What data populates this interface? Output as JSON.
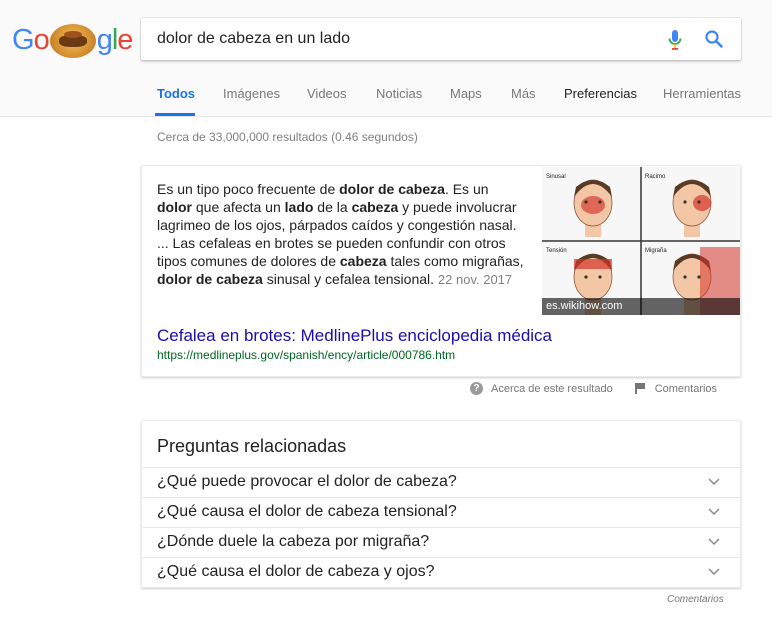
{
  "logo": {
    "letters": [
      "G",
      "o",
      "g",
      "l",
      "e"
    ]
  },
  "search": {
    "query": "dolor de cabeza en un lado"
  },
  "tabs": [
    {
      "label": "Todos"
    },
    {
      "label": "Imágenes"
    },
    {
      "label": "Videos"
    },
    {
      "label": "Noticias"
    },
    {
      "label": "Maps"
    },
    {
      "label": "Más"
    },
    {
      "label": "Preferencias"
    },
    {
      "label": "Herramientas"
    }
  ],
  "result_stats": "Cerca de 33,000,000 resultados (0.46 segundos)",
  "featured": {
    "snippet": [
      {
        "t": "Es un tipo poco frecuente de "
      },
      {
        "t": "dolor de cabeza",
        "b": true
      },
      {
        "t": ". Es un "
      },
      {
        "t": "dolor",
        "b": true
      },
      {
        "t": " que afecta un "
      },
      {
        "t": "lado",
        "b": true
      },
      {
        "t": " de la "
      },
      {
        "t": "cabeza",
        "b": true
      },
      {
        "t": " y puede involucrar lagrimeo de los ojos, párpados caídos y congestión nasal. ... Las cefaleas en brotes se pueden confundir con otros tipos comunes de dolores de "
      },
      {
        "t": "cabeza",
        "b": true
      },
      {
        "t": " tales como migrañas, "
      },
      {
        "t": "dolor de cabeza",
        "b": true
      },
      {
        "t": " sinusal y cefalea tensional."
      }
    ],
    "date": "22 nov. 2017",
    "image_labels": {
      "sinusal": "Sinusal",
      "racimo": "Racimo",
      "tension": "Tensión",
      "migrana": "Migraña"
    },
    "image_credit": "es.wikihow.com",
    "link_title": "Cefalea en brotes: MedlinePlus enciclopedia médica",
    "url": "https://medlineplus.gov/spanish/ency/article/000786.htm"
  },
  "about": {
    "about_label": "Acerca de este resultado",
    "feedback_label": "Comentarios"
  },
  "related": {
    "title": "Preguntas relacionadas",
    "questions": [
      "¿Qué puede provocar el dolor de cabeza?",
      "¿Qué causa el dolor de cabeza tensional?",
      "¿Dónde duele la cabeza por migraña?",
      "¿Qué causa el dolor de cabeza y ojos?"
    ]
  },
  "bottom_feedback": "Comentarios",
  "colors": {
    "link": "#1a0dab",
    "url": "#006621",
    "active_tab": "#1a73e8",
    "pain": "#d4342a"
  }
}
